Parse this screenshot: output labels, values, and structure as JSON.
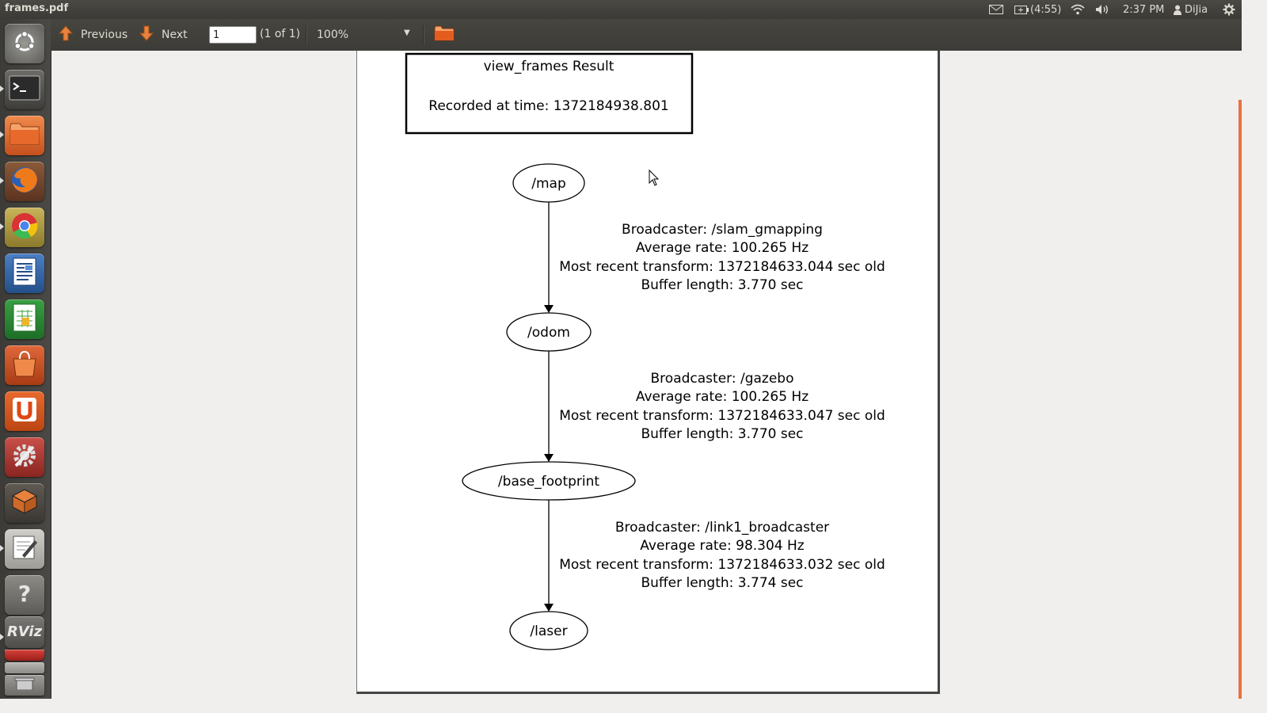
{
  "window": {
    "title": "frames.pdf"
  },
  "top_panel": {
    "battery": "(4:55)",
    "time": "2:37 PM",
    "user": "DiJia",
    "icons": [
      "mail-icon",
      "battery-icon",
      "wifi-icon",
      "volume-icon",
      "user-icon",
      "gear-icon"
    ]
  },
  "launcher": {
    "items": [
      "dash-home",
      "terminal",
      "files",
      "firefox",
      "chrome",
      "writer",
      "calc",
      "software-center",
      "ubuntu-one",
      "system-settings",
      "workspaces",
      "text-editor",
      "help",
      "rviz",
      "trash"
    ]
  },
  "toolbar": {
    "previous_label": "Previous",
    "next_label": "Next",
    "page_value": "1",
    "page_count": "(1 of 1)",
    "zoom": "100%"
  },
  "document": {
    "header_title": "view_frames Result",
    "header_recorded": "Recorded at time: 1372184938.801",
    "nodes": {
      "map": "/map",
      "odom": "/odom",
      "base_footprint": "/base_footprint",
      "laser": "/laser"
    },
    "edges": [
      {
        "broadcaster": "Broadcaster: /slam_gmapping",
        "rate": "Average rate: 100.265 Hz",
        "recent": "Most recent transform: 1372184633.044 sec old",
        "buffer": "Buffer length: 3.770 sec"
      },
      {
        "broadcaster": "Broadcaster: /gazebo",
        "rate": "Average rate: 100.265 Hz",
        "recent": "Most recent transform: 1372184633.047 sec old",
        "buffer": "Buffer length: 3.770 sec"
      },
      {
        "broadcaster": "Broadcaster: /link1_broadcaster",
        "rate": "Average rate: 98.304 Hz",
        "recent": "Most recent transform: 1372184633.032 sec old",
        "buffer": "Buffer length: 3.774 sec"
      }
    ]
  }
}
